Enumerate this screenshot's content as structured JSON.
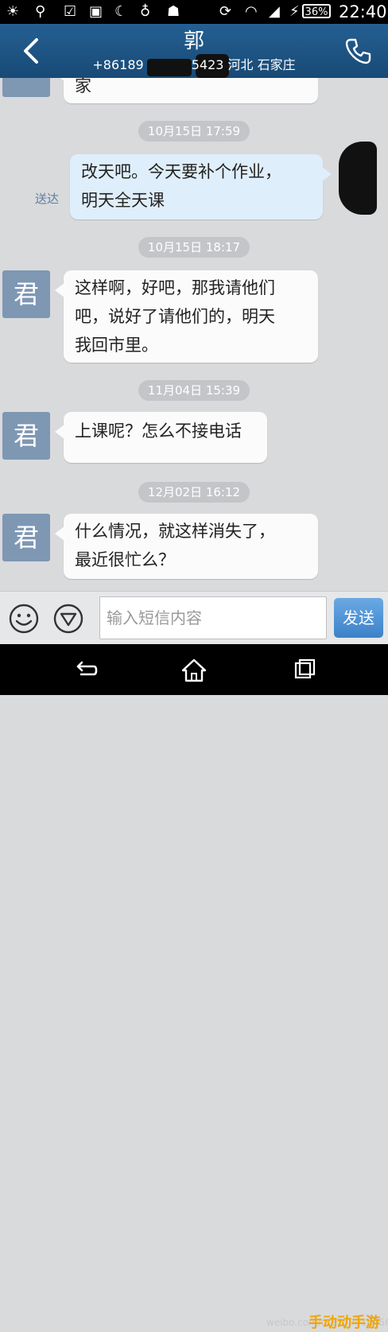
{
  "status_bar": {
    "battery": "36%",
    "time": "22:40",
    "icons": [
      "sun-icon",
      "usb-icon",
      "checkbox-icon",
      "image-icon",
      "moon-icon",
      "bulb-icon",
      "android-icon",
      "rotate-icon",
      "wifi-icon",
      "signal-icon",
      "charging-icon"
    ]
  },
  "header": {
    "name": "郭",
    "phone": "+86189",
    "phone_suffix": "5423",
    "location": "河北 石家庄",
    "back_icon": "chevron-left-icon",
    "call_icon": "phone-icon"
  },
  "conversation": {
    "partial_top": "家",
    "timestamps": [
      "10月15日 17:59",
      "10月15日 18:17",
      "11月04日 15:39",
      "12月02日 16:12"
    ],
    "messages": [
      {
        "direction": "out",
        "lines": [
          "改天吧。今天要补个作业，",
          "明天全天课"
        ],
        "status": "送达"
      },
      {
        "direction": "in",
        "avatar": "君",
        "lines": [
          "这样啊，好吧，那我请他们",
          "吧，说好了请他们的，明天",
          "我回市里。"
        ]
      },
      {
        "direction": "in",
        "avatar": "君",
        "lines": [
          "上课呢？怎么不接电话"
        ]
      },
      {
        "direction": "in",
        "avatar": "君",
        "lines": [
          "什么情况，就这样消失了，",
          "最近很忙么？"
        ]
      }
    ]
  },
  "input_bar": {
    "placeholder": "输入短信内容",
    "send_label": "发送"
  },
  "nav_bar": {
    "watermark": "weibo.com/u/3759018456",
    "watermark_brand": "手动动手游"
  }
}
